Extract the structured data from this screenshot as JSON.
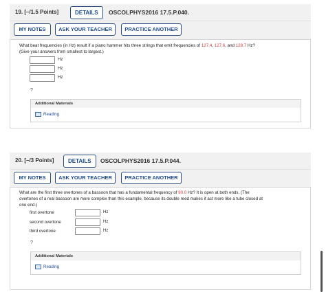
{
  "q1": {
    "number": "19.  [–/1.5 Points]",
    "details_label": "DETAILS",
    "code": "OSCOLPHYS2016 17.5.P.040.",
    "buttons": {
      "my_notes": "MY NOTES",
      "ask_teacher": "ASK YOUR TEACHER",
      "practice": "PRACTICE ANOTHER"
    },
    "text": {
      "pre": "What beat frequencies (in Hz) result if a piano hammer hits three strings that emit frequencies of ",
      "v1": "127.4",
      "sep1": ", ",
      "v2": "127.6",
      "sep2": ", and ",
      "v3": "128.7",
      "post": " Hz?",
      "line2": "(Give your answers from smallest to largest.)"
    },
    "answers": [
      {
        "unit": "Hz"
      },
      {
        "unit": "Hz"
      },
      {
        "unit": "Hz"
      }
    ],
    "help": "?",
    "additional": {
      "title": "Additional Materials",
      "reading": "Reading"
    }
  },
  "q2": {
    "number": "20.  [–/3 Points]",
    "details_label": "DETAILS",
    "code": "OSCOLPHYS2016 17.5.P.044.",
    "buttons": {
      "my_notes": "MY NOTES",
      "ask_teacher": "ASK YOUR TEACHER",
      "practice": "PRACTICE ANOTHER"
    },
    "text": {
      "pre": "What are the first three overtones of a bassoon that has a fundamental frequency of ",
      "v1": "90.0",
      "post": " Hz? It is open at both ends. (The",
      "line2": "overtones of a real bassoon are more complex than this example, because its double reed makes it act more like a tube closed at",
      "line3": "one end.)"
    },
    "answers": [
      {
        "label": "first overtone",
        "unit": "Hz"
      },
      {
        "label": "second overtone",
        "unit": "Hz"
      },
      {
        "label": "third overtone",
        "unit": "Hz"
      }
    ],
    "help": "?",
    "additional": {
      "title": "Additional Materials",
      "reading": "Reading"
    }
  },
  "colors": {
    "accent": "#1f4a8a",
    "highlight": "#d33b3b",
    "header_bg": "#f1f1f1"
  }
}
